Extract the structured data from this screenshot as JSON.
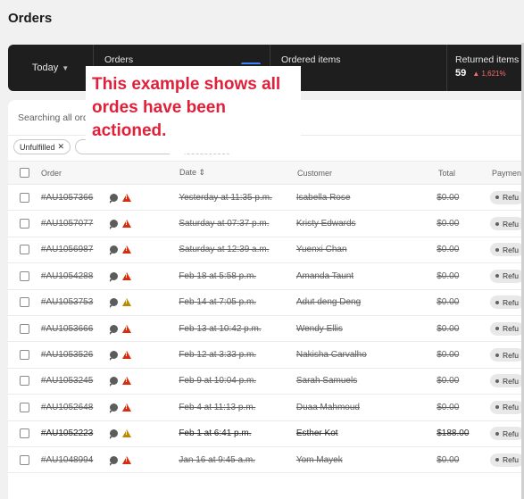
{
  "page": {
    "title": "Orders"
  },
  "stats": {
    "range_label": "Today",
    "orders_label": "Orders",
    "ordered_items_label": "Ordered items",
    "returned_items_label": "Returned items",
    "returned_items_value": "59",
    "returned_items_change": "1,621%",
    "spark_color": "#3b82f6"
  },
  "search": {
    "placeholder": "Searching all ord"
  },
  "filters": [
    {
      "label": "Unfulfilled"
    }
  ],
  "table": {
    "headers": {
      "order": "Order",
      "date": "Date",
      "customer": "Customer",
      "total": "Total",
      "payment": "Paymen"
    },
    "rows": [
      {
        "order": "#AU1057366",
        "date": "Yesterday at 11:35 p.m.",
        "customer": "Isabella Rose",
        "total": "$0.00",
        "payment": "Refu",
        "warning": "red"
      },
      {
        "order": "#AU1057077",
        "date": "Saturday at 07:37 p.m.",
        "customer": "Kristy Edwards",
        "total": "$0.00",
        "payment": "Refu",
        "warning": "red"
      },
      {
        "order": "#AU1056987",
        "date": "Saturday at 12:39 a.m.",
        "customer": "Yuenxi Chan",
        "total": "$0.00",
        "payment": "Refu",
        "warning": "red"
      },
      {
        "order": "#AU1054288",
        "date": "Feb 18 at 5:58 p.m.",
        "customer": "Amanda Taunt",
        "total": "$0.00",
        "payment": "Refu",
        "warning": "red"
      },
      {
        "order": "#AU1053753",
        "date": "Feb 14 at 7:05 p.m.",
        "customer": "Adut deng Deng",
        "total": "$0.00",
        "payment": "Refu",
        "warning": "amber"
      },
      {
        "order": "#AU1053666",
        "date": "Feb 13 at 10:42 p.m.",
        "customer": "Wendy Ellis",
        "total": "$0.00",
        "payment": "Refu",
        "warning": "red"
      },
      {
        "order": "#AU1053526",
        "date": "Feb 12 at 3:33 p.m.",
        "customer": "Nakisha Carvalho",
        "total": "$0.00",
        "payment": "Refu",
        "warning": "red"
      },
      {
        "order": "#AU1053245",
        "date": "Feb 9 at 10:04 p.m.",
        "customer": "Sarah Samuels",
        "total": "$0.00",
        "payment": "Refu",
        "warning": "red"
      },
      {
        "order": "#AU1052648",
        "date": "Feb 4 at 11:13 p.m.",
        "customer": "Duaa Mahmoud",
        "total": "$0.00",
        "payment": "Refu",
        "warning": "red"
      },
      {
        "order": "#AU1052223",
        "date": "Feb 1 at 6:41 p.m.",
        "customer": "Esther Kot",
        "total": "$188.00",
        "payment": "Refu",
        "warning": "amber"
      },
      {
        "order": "#AU1048994",
        "date": "Jan 16 at 9:45 a.m.",
        "customer": "Yom Mayek",
        "total": "$0.00",
        "payment": "Refu",
        "warning": "red"
      }
    ]
  },
  "annotation": {
    "text": "This example shows all ordes have been actioned."
  },
  "colors": {
    "annotation": "#e0203a",
    "warning_red": "#d72c0d",
    "warning_amber": "#b98900"
  }
}
